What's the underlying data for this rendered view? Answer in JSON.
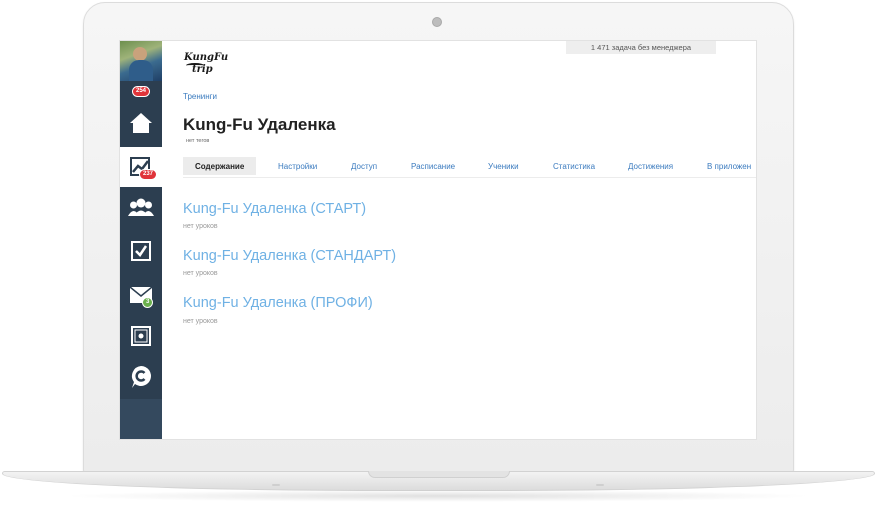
{
  "sidebar": {
    "avatar_badge": "254",
    "items": [
      {
        "icon": "home-icon"
      },
      {
        "icon": "chart-icon",
        "badge": "237",
        "active": true
      },
      {
        "icon": "users-icon"
      },
      {
        "icon": "checkbox-icon"
      },
      {
        "icon": "mail-icon",
        "badge": "3"
      },
      {
        "icon": "safe-icon"
      },
      {
        "icon": "chat-icon"
      }
    ]
  },
  "header": {
    "logo_line1": "KungFu",
    "logo_line2": "trip",
    "top_notice": "1 471 задача без менеджера"
  },
  "breadcrumb": "Тренинги",
  "page_title": "Kung-Fu Удаленка",
  "tags_note": "нет тегов",
  "tabs": [
    {
      "label": "Содержание",
      "active": true
    },
    {
      "label": "Настройки"
    },
    {
      "label": "Доступ"
    },
    {
      "label": "Расписание"
    },
    {
      "label": "Ученики"
    },
    {
      "label": "Статистика"
    },
    {
      "label": "Достижения"
    },
    {
      "label": "В приложен"
    }
  ],
  "courses": [
    {
      "title": "Kung-Fu Удаленка (СТАРТ)",
      "subtitle": "нет уроков"
    },
    {
      "title": "Kung-Fu Удаленка (СТАНДАРТ)",
      "subtitle": "нет уроков"
    },
    {
      "title": "Kung-Fu Удаленка (ПРОФИ)",
      "subtitle": "нет уроков"
    }
  ],
  "colors": {
    "sidebar_bg": "#2c3e50",
    "link": "#3b7bbf",
    "course_link": "#6fb1e4",
    "badge_red": "#e0343a",
    "badge_green": "#6ab04c"
  }
}
